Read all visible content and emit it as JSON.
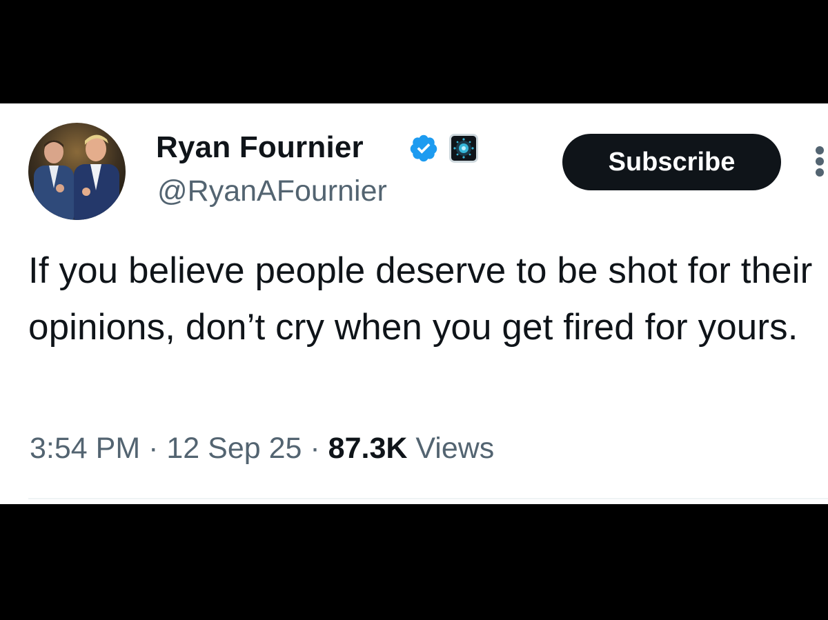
{
  "tweet": {
    "author": {
      "display_name": "Ryan Fournier",
      "handle": "@RyanAFournier",
      "verified_icon": "verified-badge-icon",
      "affiliation_icon": "affiliate-badge-icon",
      "avatar": "avatar-photo"
    },
    "subscribe_label": "Subscribe",
    "more_icon": "more-options-icon",
    "text": "If you believe people deserve to be shot for their opinions, don’t cry when you get fired for yours.",
    "time": "3:54 PM",
    "separator": "·",
    "date": "12 Sep 25",
    "views_count": "87.3K",
    "views_label": "Views"
  },
  "colors": {
    "text_primary": "#0f1419",
    "text_secondary": "#536471",
    "verified_blue": "#1d9bf0",
    "button_bg": "#0f1419",
    "background": "#ffffff",
    "letterbox": "#000000"
  }
}
